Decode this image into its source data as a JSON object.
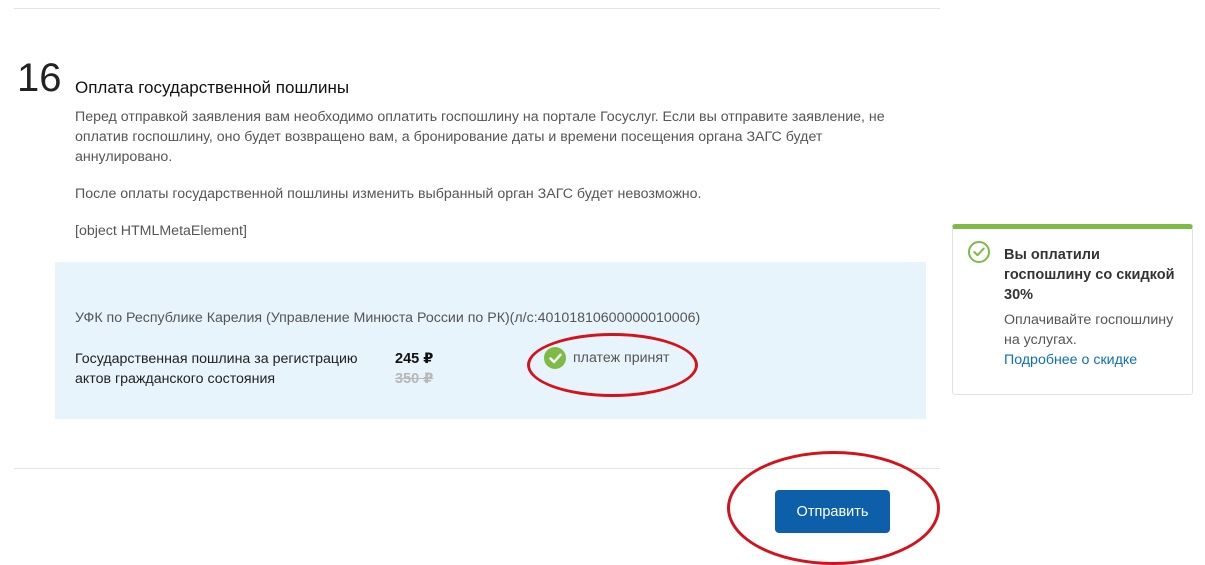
{
  "step": {
    "number": "16",
    "title": "Оплата государственной пошлины",
    "paragraph1": "Перед отправкой заявления вам необходимо оплатить госпошлину на портале Госуслуг. Если вы отправите заявление, не оплатив госпошлину, оно будет возвращено вам, а бронирование даты и времени посещения органа ЗАГС будет аннулировано.",
    "paragraph2": "После оплаты государственной пошлины изменить выбранный орган ЗАГС будет невозможно.",
    "paragraph3": "[object HTMLMetaElement]"
  },
  "payment": {
    "recipient": "УФК по Республике Карелия (Управление Минюста России по РК)(л/с:40101810600000010006)",
    "fee_name": "Государственная пошлина за регистрацию актов гражданского состояния",
    "price_new": "245 ₽",
    "price_old": "350 ₽",
    "status": "платеж принят"
  },
  "actions": {
    "submit_label": "Отправить"
  },
  "promo": {
    "title": "Вы оплатили госпошлину со скидкой 30%",
    "text": "Оплачивайте госпошлину на услугах.",
    "link": "Подробнее о скидке"
  },
  "colors": {
    "accent_green": "#7dbb45",
    "button_blue": "#0d5faa",
    "link_blue": "#0d6fb8",
    "box_bg": "#e8f4fb",
    "annotation_red": "#d4121b"
  },
  "icons": {
    "status": "check-circle-icon",
    "promo": "check-circle-outline-icon"
  }
}
